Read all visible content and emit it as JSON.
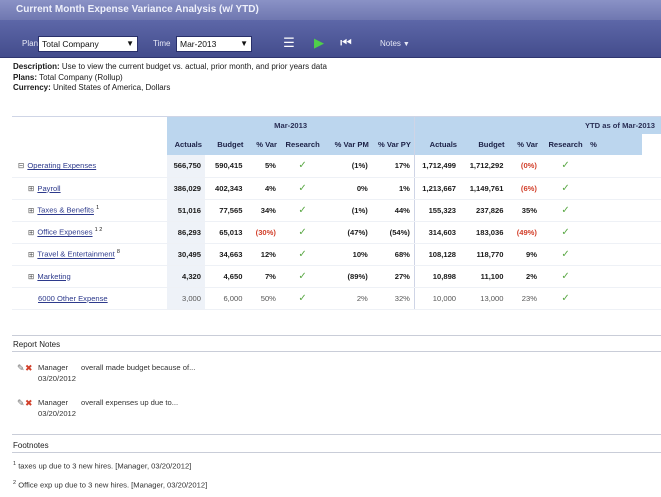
{
  "window": {
    "title": "Current Month Expense Variance Analysis (w/ YTD)"
  },
  "toolbar": {
    "plan_label": "Plan",
    "plan_value": "Total Company",
    "time_label": "Time",
    "time_value": "Mar-2013",
    "notes_label": "Notes",
    "icons": [
      "list-icon",
      "play-icon",
      "skip-back-icon"
    ]
  },
  "description": {
    "description_label": "Description:",
    "description_text": "Use to view the current budget vs. actual, prior month, and prior years data",
    "plans_label": "Plans:",
    "plans_text": "Total Company (Rollup)",
    "currency_label": "Currency:",
    "currency_text": "United States of America, Dollars"
  },
  "grid": {
    "group_headers": [
      "Mar-2013",
      "YTD as of Mar-2013"
    ],
    "columns_current": [
      "Actuals",
      "Budget",
      "% Var",
      "Research",
      "% Var PM",
      "% Var PY"
    ],
    "columns_ytd": [
      "Actuals",
      "Budget",
      "% Var",
      "Research",
      "%"
    ],
    "rows": [
      {
        "label": "Operating Expenses",
        "expander": "⊟",
        "sup": "",
        "cells": [
          "566,750",
          "590,415",
          "5%",
          "✓",
          "(1%)",
          "17%",
          "1,712,499",
          "1,712,292",
          "(0%)",
          "✓"
        ],
        "neg": [
          false,
          false,
          false,
          false,
          false,
          false,
          false,
          false,
          true,
          false
        ]
      },
      {
        "label": "Payroll",
        "expander": "⊞",
        "sup": "",
        "cells": [
          "386,029",
          "402,343",
          "4%",
          "✓",
          "0%",
          "1%",
          "1,213,667",
          "1,149,761",
          "(6%)",
          "✓"
        ],
        "neg": [
          false,
          false,
          false,
          false,
          false,
          false,
          false,
          false,
          true,
          false
        ]
      },
      {
        "label": "Taxes & Benefits",
        "expander": "⊞",
        "sup": "1",
        "cells": [
          "51,016",
          "77,565",
          "34%",
          "✓",
          "(1%)",
          "44%",
          "155,323",
          "237,826",
          "35%",
          "✓"
        ],
        "neg": [
          false,
          false,
          false,
          false,
          false,
          false,
          false,
          false,
          false,
          false
        ]
      },
      {
        "label": "Office Expenses",
        "expander": "⊞",
        "sup": "1 2",
        "cells": [
          "86,293",
          "65,013",
          "(30%)",
          "✓",
          "(47%)",
          "(54%)",
          "314,603",
          "183,036",
          "(49%)",
          "✓"
        ],
        "neg": [
          false,
          false,
          true,
          false,
          false,
          false,
          false,
          false,
          true,
          false
        ]
      },
      {
        "label": "Travel & Entertainment",
        "expander": "⊞",
        "sup": "8",
        "cells": [
          "30,495",
          "34,663",
          "12%",
          "✓",
          "10%",
          "68%",
          "108,128",
          "118,770",
          "9%",
          "✓"
        ],
        "neg": [
          false,
          false,
          false,
          false,
          false,
          false,
          false,
          false,
          false,
          false
        ]
      },
      {
        "label": "Marketing",
        "expander": "⊞",
        "sup": "",
        "cells": [
          "4,320",
          "4,650",
          "7%",
          "✓",
          "(89%)",
          "27%",
          "10,898",
          "11,100",
          "2%",
          "✓"
        ],
        "neg": [
          false,
          false,
          false,
          false,
          false,
          false,
          false,
          false,
          false,
          false
        ]
      },
      {
        "label": "6000 Other Expense",
        "expander": "",
        "sup": "",
        "cells": [
          "3,000",
          "6,000",
          "50%",
          "✓",
          "2%",
          "32%",
          "10,000",
          "13,000",
          "23%",
          "✓"
        ],
        "neg": [
          false,
          false,
          false,
          false,
          false,
          false,
          false,
          false,
          false,
          false
        ]
      }
    ]
  },
  "report_notes": {
    "title": "Report Notes",
    "items": [
      {
        "author": "Manager",
        "date": "03/20/2012",
        "text": "overall made budget because of..."
      },
      {
        "author": "Manager",
        "date": "03/20/2012",
        "text": "overall expenses up due to..."
      }
    ]
  },
  "footnotes": {
    "title": "Footnotes",
    "items": [
      {
        "num": "1",
        "text": "taxes up due to 3 new hires. [Manager, 03/20/2012]"
      },
      {
        "num": "2",
        "text": "Office exp up due to 3 new hires. [Manager, 03/20/2012]"
      }
    ]
  },
  "colors": {
    "title_bar": "#7a82bc",
    "toolbar": "#4f5898",
    "header_cells": "#bcd6ee",
    "negative": "#d23f2a",
    "check": "#5aa845",
    "link": "#2d3a8c"
  }
}
